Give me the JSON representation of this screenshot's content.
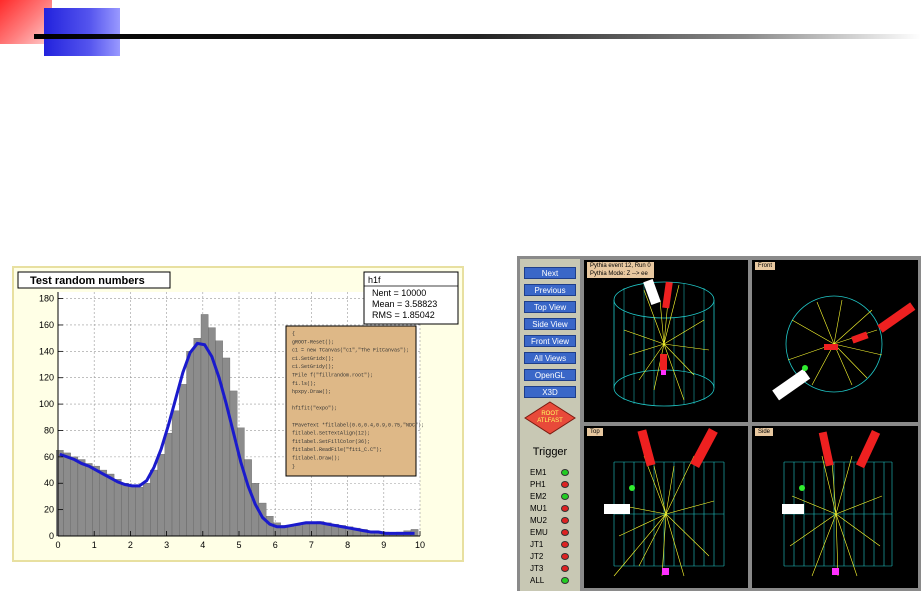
{
  "histogram": {
    "title": "Test random numbers",
    "stats": {
      "name": "h1f",
      "nent": "Nent = 10000",
      "mean": "Mean = 3.58823",
      "rms": "RMS  = 1.85042"
    },
    "code_lines": [
      "{",
      "gROOT-Reset();",
      "c1 = new TCanvas(\"c1\",\"The FitCanvas\");",
      "c1.SetGridx();",
      "c1.SetGridy();",
      "TFile f(\"fillrandom.root\");",
      "f1.ls();",
      "hpxpy.Draw();",
      "",
      "hf1fit(\"expo\");",
      "",
      "TPaveText *fitlabel(0.6,0.4,0.9,0.75,\"NDC\");",
      "fitlabel.SetTextAlign(12);",
      "fitlabel.SetFillColor(36);",
      "fitlabel.ReadFile(\"fit1_C.C\");",
      "fitlabel.Draw();",
      "}"
    ]
  },
  "chart_data": {
    "type": "bar",
    "title": "Test random numbers",
    "xlabel": "",
    "ylabel": "",
    "xlim": [
      0,
      10
    ],
    "ylim": [
      0,
      185
    ],
    "x_ticks": [
      "0",
      "1",
      "2",
      "3",
      "4",
      "5",
      "6",
      "7",
      "8",
      "9",
      "10"
    ],
    "y_ticks": [
      "0",
      "20",
      "40",
      "60",
      "80",
      "100",
      "120",
      "140",
      "160",
      "180"
    ],
    "grid": true,
    "x": [
      0.05,
      0.25,
      0.45,
      0.65,
      0.85,
      1.05,
      1.25,
      1.45,
      1.65,
      1.85,
      2.05,
      2.25,
      2.45,
      2.65,
      2.85,
      3.05,
      3.25,
      3.45,
      3.65,
      3.85,
      4.05,
      4.25,
      4.45,
      4.65,
      4.85,
      5.05,
      5.25,
      5.45,
      5.65,
      5.85,
      6.05,
      6.25,
      6.45,
      6.65,
      6.85,
      7.05,
      7.25,
      7.45,
      7.65,
      7.85,
      8.05,
      8.25,
      8.45,
      8.65,
      8.85,
      9.05,
      9.25,
      9.45,
      9.65,
      9.85
    ],
    "values": [
      65,
      63,
      60,
      58,
      55,
      53,
      50,
      47,
      43,
      40,
      38,
      37,
      40,
      50,
      62,
      78,
      95,
      115,
      140,
      150,
      168,
      158,
      148,
      135,
      110,
      82,
      58,
      40,
      25,
      15,
      10,
      8,
      7,
      8,
      9,
      10,
      11,
      10,
      9,
      8,
      7,
      6,
      5,
      4,
      3,
      3,
      2,
      3,
      4,
      5
    ],
    "fit_curve": [
      62,
      60,
      58,
      55,
      53,
      50,
      47,
      44,
      41,
      39,
      38,
      38,
      42,
      52,
      66,
      84,
      104,
      124,
      139,
      146,
      145,
      136,
      120,
      100,
      78,
      56,
      38,
      24,
      14,
      9,
      7,
      7,
      8,
      9,
      10,
      10,
      10,
      9,
      8,
      7,
      6,
      5,
      4,
      3,
      3,
      2,
      2,
      2,
      2,
      2
    ],
    "colors": {
      "bars": "#8c8c8c",
      "fit": "#1a1acc",
      "background": "#ffffe6",
      "code_box": "#deb887"
    }
  },
  "atlfast": {
    "menu": [
      "Next",
      "Previous",
      "Top View",
      "Side View",
      "Front View",
      "All Views",
      "OpenGL",
      "X3D"
    ],
    "logo_text": [
      "ROOT",
      "ATLFAST"
    ],
    "trigger_title": "Trigger",
    "triggers": [
      {
        "label": "EM1",
        "color": "#22cc22"
      },
      {
        "label": "PH1",
        "color": "#dd2222"
      },
      {
        "label": "EM2",
        "color": "#22cc22"
      },
      {
        "label": "MU1",
        "color": "#dd2222"
      },
      {
        "label": "MU2",
        "color": "#dd2222"
      },
      {
        "label": "EMU",
        "color": "#dd2222"
      },
      {
        "label": "JT1",
        "color": "#dd2222"
      },
      {
        "label": "JT2",
        "color": "#dd2222"
      },
      {
        "label": "JT3",
        "color": "#dd2222"
      },
      {
        "label": "ALL",
        "color": "#22cc22"
      }
    ],
    "views": [
      {
        "tag1": "Pythia event 12, Run 0",
        "tag2": "Pythia Mode: Z --> ee"
      },
      {
        "tag1": "Front"
      },
      {
        "tag1": "Top"
      },
      {
        "tag1": "Side"
      }
    ]
  }
}
